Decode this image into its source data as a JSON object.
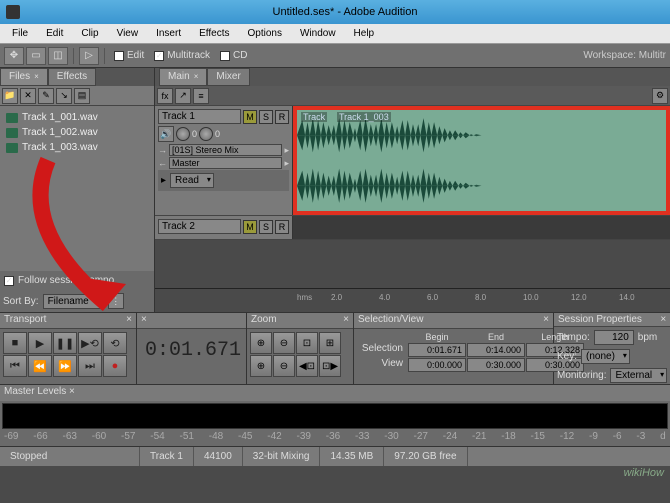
{
  "title": "Untitled.ses* - Adobe Audition",
  "menus": [
    "File",
    "Edit",
    "Clip",
    "View",
    "Insert",
    "Effects",
    "Options",
    "Window",
    "Help"
  ],
  "toolbar": {
    "edit": "Edit",
    "multitrack": "Multitrack",
    "cd": "CD",
    "workspace_label": "Workspace:",
    "workspace_value": "Multitr"
  },
  "panels": {
    "files_tab": "Files",
    "effects_tab": "Effects",
    "files": [
      "Track 1_001.wav",
      "Track 1_002.wav",
      "Track 1_003.wav"
    ],
    "follow_tempo": "Follow session tempo",
    "sort_label": "Sort By:",
    "sort_value": "Filename"
  },
  "main": {
    "main_tab": "Main",
    "mixer_tab": "Mixer",
    "tracks": [
      {
        "name": "Track 1",
        "vol": "0",
        "pan": "0",
        "input": "[01S] Stereo Mix",
        "output": "Master",
        "clip_a": "Track",
        "clip_b": "Track 1_003"
      },
      {
        "name": "Track 2"
      }
    ],
    "read": "Read",
    "ruler_unit": "hms",
    "ruler_ticks": [
      "2.0",
      "4.0",
      "6.0",
      "8.0",
      "10.0",
      "12.0",
      "14.0"
    ]
  },
  "transport": {
    "title": "Transport"
  },
  "time": {
    "value": "0:01.671"
  },
  "zoom": {
    "title": "Zoom"
  },
  "selview": {
    "title": "Selection/View",
    "begin": "Begin",
    "end": "End",
    "length": "Length",
    "sel_label": "Selection",
    "view_label": "View",
    "sel": [
      "0:01.671",
      "0:14.000",
      "0:12.328"
    ],
    "view": [
      "0:00.000",
      "0:30.000",
      "0:30.000"
    ]
  },
  "session": {
    "title": "Session Properties",
    "tempo_label": "Tempo:",
    "tempo": "120",
    "bpm": "bpm",
    "key_label": "Key:",
    "key": "(none)",
    "mon_label": "Monitoring:",
    "mon": "External"
  },
  "master": {
    "title": "Master Levels"
  },
  "db": [
    "-69",
    "-66",
    "-63",
    "-60",
    "-57",
    "-54",
    "-51",
    "-48",
    "-45",
    "-42",
    "-39",
    "-36",
    "-33",
    "-30",
    "-27",
    "-24",
    "-21",
    "-18",
    "-15",
    "-12",
    "-9",
    "-6",
    "-3",
    "d"
  ],
  "status": {
    "state": "Stopped",
    "track": "Track 1",
    "rate": "44100",
    "bit": "32-bit Mixing",
    "size": "14.35 MB",
    "free": "97.20 GB free"
  },
  "watermark": "wikiHow"
}
